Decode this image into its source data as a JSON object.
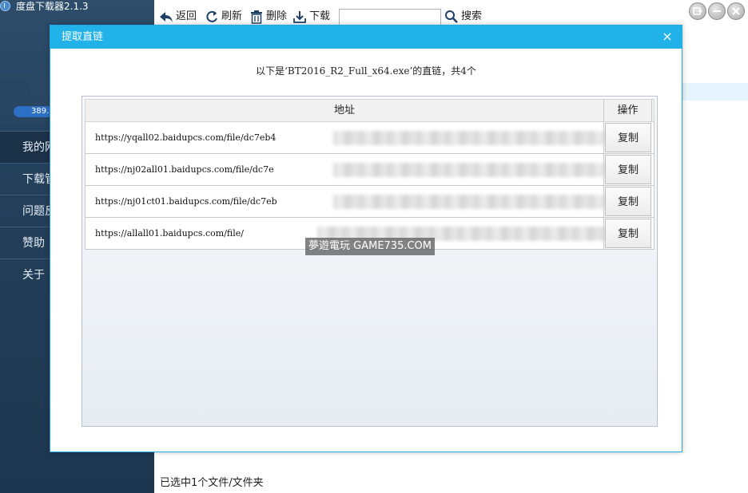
{
  "app": {
    "title": "度盘下载器2.1.3",
    "quota": "389."
  },
  "sidebar": {
    "items": [
      {
        "label": "我的网"
      },
      {
        "label": "下载管"
      },
      {
        "label": "问题反"
      },
      {
        "label": "赞助"
      },
      {
        "label": "关于"
      }
    ]
  },
  "toolbar": {
    "back_label": "返回",
    "refresh_label": "刷新",
    "delete_label": "删除",
    "download_label": "下载",
    "search_value": "",
    "search_label": "搜索"
  },
  "window_controls": {
    "restore_icon": "restore-icon",
    "minimize_icon": "minimize-icon",
    "close_icon": "close-icon"
  },
  "dialog": {
    "title": "提取直链",
    "close_glyph": "×",
    "message": "以下是‘BT2016_R2_Full_x64.exe’的直链，共4个",
    "columns": {
      "address": "地址",
      "action": "操作"
    },
    "rows": [
      {
        "url": "https://yqall02.baidupcs.com/file/dc7eb4",
        "copy_label": "复制"
      },
      {
        "url": "https://nj02all01.baidupcs.com/file/dc7e",
        "copy_label": "复制"
      },
      {
        "url": "https://nj01ct01.baidupcs.com/file/dc7eb",
        "copy_label": "复制"
      },
      {
        "url": "https://allall01.baidupcs.com/file/",
        "copy_label": "复制"
      }
    ]
  },
  "watermark": "夢遊電玩 GAME735.COM",
  "status": {
    "selection_text": "已选中1个文件/文件夹"
  },
  "colors": {
    "accent": "#22b2ea",
    "sidebar_bg": "#233f5a"
  }
}
